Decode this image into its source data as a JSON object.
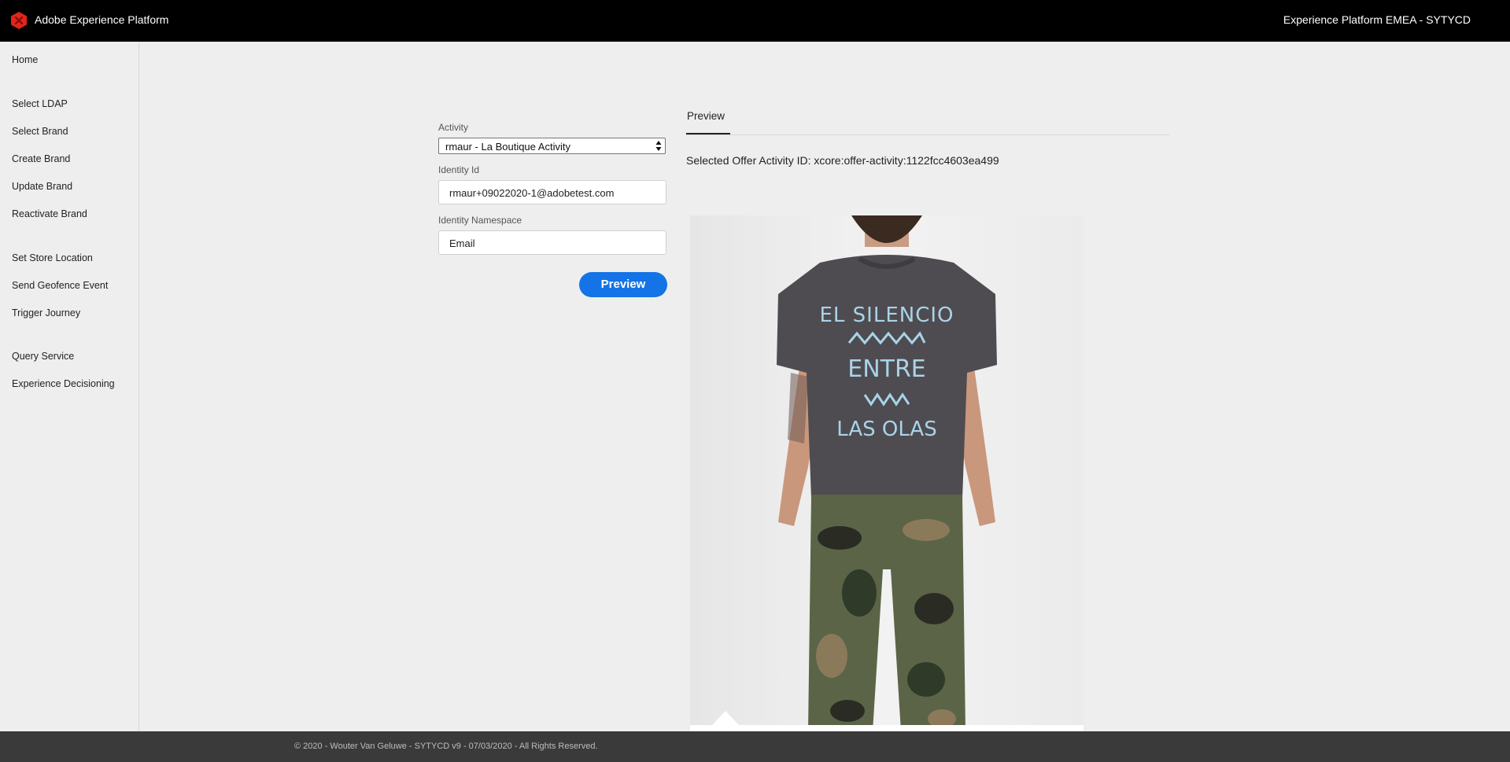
{
  "header": {
    "app_title": "Adobe Experience Platform",
    "org_name": "Experience Platform EMEA - SYTYCD",
    "logo_icon": "adobe-logo-icon",
    "logo_color": "#e1251b"
  },
  "sidebar": {
    "items": [
      {
        "label": "Home"
      },
      {
        "label": "Select LDAP"
      },
      {
        "label": "Select Brand"
      },
      {
        "label": "Create Brand"
      },
      {
        "label": "Update Brand"
      },
      {
        "label": "Reactivate Brand"
      },
      {
        "label": "Set Store Location"
      },
      {
        "label": "Send Geofence Event"
      },
      {
        "label": "Trigger Journey"
      },
      {
        "label": "Query Service"
      },
      {
        "label": "Experience Decisioning"
      }
    ]
  },
  "form": {
    "activity_label": "Activity",
    "activity_value": "rmaur - La Boutique Activity",
    "identity_id_label": "Identity Id",
    "identity_id_value": "rmaur+09022020-1@adobetest.com",
    "identity_namespace_label": "Identity Namespace",
    "identity_namespace_value": "Email",
    "preview_button": "Preview",
    "accent_color": "#1473e6"
  },
  "preview_panel": {
    "tab_label": "Preview",
    "offer_text": "Selected Offer Activity ID: xcore:offer-activity:1122fcc4603ea499",
    "image_subject": "man wearing grey t-shirt and camouflage pants",
    "shirt_print": [
      "EL SILENCIO",
      "ENTRE",
      "LAS OLAS"
    ]
  },
  "footer": {
    "text": "© 2020 - Wouter Van Geluwe - SYTYCD v9 - 07/03/2020 - All Rights Reserved."
  }
}
